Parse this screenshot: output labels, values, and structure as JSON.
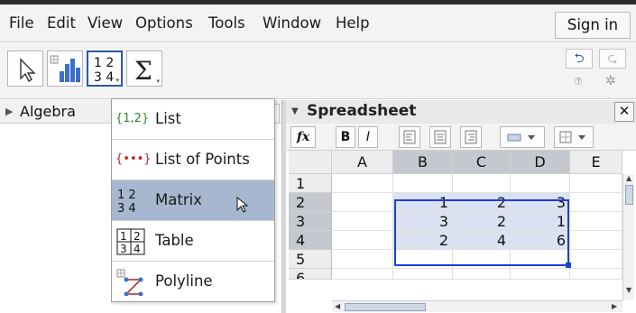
{
  "menu": [
    "File",
    "Edit",
    "View",
    "Options",
    "Tools",
    "Window",
    "Help"
  ],
  "signin_label": "Sign in",
  "toolbar": {
    "tools": [
      "move-tool",
      "one-variable-analysis-tool",
      "matrix-tool",
      "sum-tool"
    ],
    "active_tool": "matrix-tool",
    "undo_icon": "undo-icon",
    "redo_icon": "redo-icon"
  },
  "algebra": {
    "title": "Algebra"
  },
  "dropdown": {
    "items": [
      {
        "label": "List",
        "icon": "list-icon",
        "icon_text": "{1,2}"
      },
      {
        "label": "List of Points",
        "icon": "list-of-points-icon",
        "icon_text": "{•••}"
      },
      {
        "label": "Matrix",
        "icon": "matrix-icon",
        "selected": true
      },
      {
        "label": "Table",
        "icon": "table-icon"
      },
      {
        "label": "Polyline",
        "icon": "polyline-icon"
      }
    ]
  },
  "spreadsheet": {
    "title": "Spreadsheet",
    "toolbar": {
      "fx": "fx",
      "bold": "B",
      "italic": "I"
    },
    "columns": [
      "A",
      "B",
      "C",
      "D",
      "E"
    ],
    "rows": [
      {
        "label": "1",
        "cells": [
          "",
          "",
          "",
          "",
          ""
        ]
      },
      {
        "label": "2",
        "cells": [
          "",
          "1",
          "2",
          "3",
          ""
        ]
      },
      {
        "label": "3",
        "cells": [
          "",
          "3",
          "2",
          "1",
          ""
        ]
      },
      {
        "label": "4",
        "cells": [
          "",
          "2",
          "4",
          "6",
          ""
        ]
      },
      {
        "label": "5",
        "cells": [
          "",
          "",
          "",
          "",
          ""
        ]
      },
      {
        "label": "6",
        "cells": [
          "",
          "",
          "",
          "",
          ""
        ]
      }
    ]
  },
  "colors": {
    "selection": "#1d3fdb",
    "selected_fill": "#dbe3f2",
    "menu_highlight": "#a6b7cf"
  }
}
